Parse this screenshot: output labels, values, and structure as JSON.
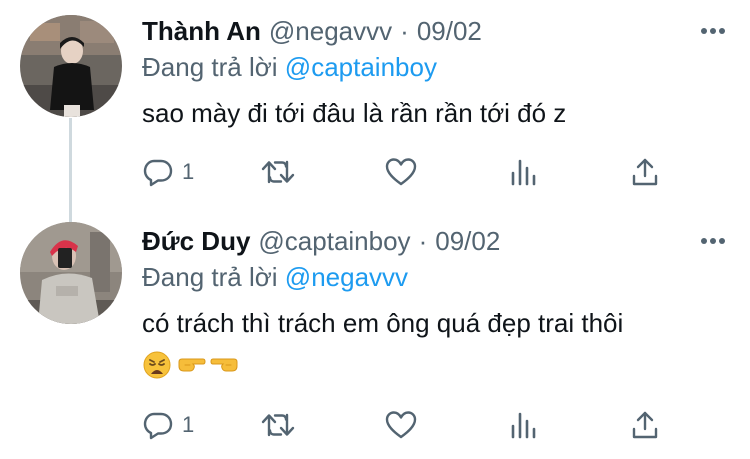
{
  "tweets": [
    {
      "name": "Thành An",
      "handle": "@negavvv",
      "separator": "·",
      "date": "09/02",
      "reply_prefix": "Đang trả lời",
      "reply_to": "@captainboy",
      "text": "sao mày đi tới đâu là rần rần tới đó z",
      "reply_count": "1",
      "icons": [
        "more-icon",
        "reply-icon",
        "retweet-icon",
        "like-icon",
        "analytics-icon",
        "share-icon"
      ]
    },
    {
      "name": "Đức Duy",
      "handle": "@captainboy",
      "separator": "·",
      "date": "09/02",
      "reply_prefix": "Đang trả lời",
      "reply_to": "@negavvv",
      "text": "có trách thì trách em ông quá đẹp trai thôi",
      "emojis": [
        "😩",
        "👉",
        "👈"
      ],
      "reply_count": "1",
      "icons": [
        "more-icon",
        "reply-icon",
        "retweet-icon",
        "like-icon",
        "analytics-icon",
        "share-icon"
      ]
    }
  ],
  "colors": {
    "text": "#0f1419",
    "secondary": "#536471",
    "link": "#1d9bf0",
    "thread_line": "#cfd9de"
  }
}
